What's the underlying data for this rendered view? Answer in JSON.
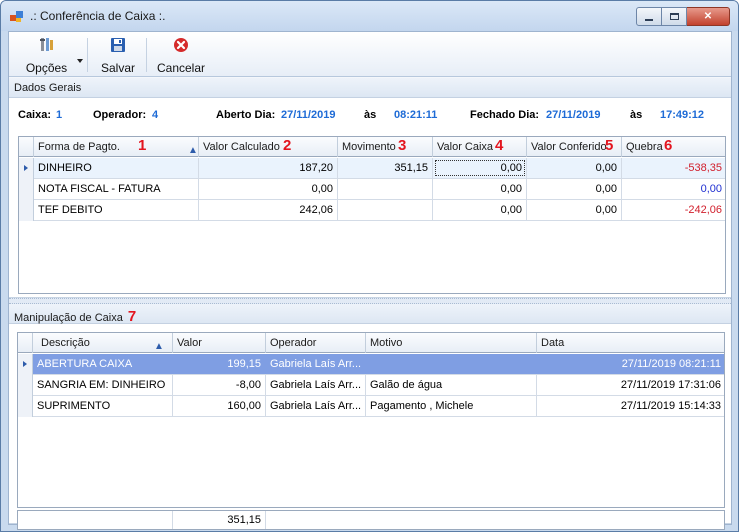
{
  "window": {
    "title": ".: Conferência de Caixa :."
  },
  "toolbar": {
    "opcoes": "Opções",
    "salvar": "Salvar",
    "cancelar": "Cancelar"
  },
  "dados": {
    "heading": "Dados Gerais",
    "caixa_label": "Caixa:",
    "caixa_value": "1",
    "operador_label": "Operador:",
    "operador_value": "4",
    "aberto_label": "Aberto Dia:",
    "aberto_date": "27/11/2019",
    "as1": "às",
    "aberto_time": "08:21:11",
    "fechado_label": "Fechado Dia:",
    "fechado_date": "27/11/2019",
    "as2": "às",
    "fechado_time": "17:49:12"
  },
  "grid1": {
    "columns": [
      {
        "label": "Forma de Pagto.",
        "num": "1"
      },
      {
        "label": "Valor Calculado",
        "num": "2"
      },
      {
        "label": "Movimento",
        "num": "3"
      },
      {
        "label": "Valor Caixa",
        "num": "4"
      },
      {
        "label": "Valor Conferido",
        "num": "5"
      },
      {
        "label": "Quebra",
        "num": "6"
      }
    ],
    "rows": [
      [
        "DINHEIRO",
        "187,20",
        "351,15",
        "0,00",
        "0,00",
        "-538,35"
      ],
      [
        "NOTA FISCAL - FATURA",
        "0,00",
        "",
        "0,00",
        "0,00",
        "0,00"
      ],
      [
        "TEF DEBITO",
        "242,06",
        "",
        "0,00",
        "0,00",
        "-242,06"
      ]
    ]
  },
  "manip": {
    "heading": "Manipulação de Caixa",
    "num": "7"
  },
  "grid2": {
    "columns": [
      "Descrição",
      "Valor",
      "Operador",
      "Motivo",
      "Data"
    ],
    "rows": [
      [
        "ABERTURA CAIXA",
        "199,15",
        "Gabriela Laís Arr...",
        "",
        "27/11/2019 08:21:11"
      ],
      [
        "SANGRIA EM: DINHEIRO",
        "-8,00",
        "Gabriela Laís Arr...",
        "Galão de água",
        "27/11/2019 17:31:06"
      ],
      [
        "SUPRIMENTO",
        "160,00",
        "Gabriela Laís Arr...",
        "Pagamento , Michele",
        "27/11/2019 15:14:33"
      ]
    ],
    "total": "351,15"
  }
}
